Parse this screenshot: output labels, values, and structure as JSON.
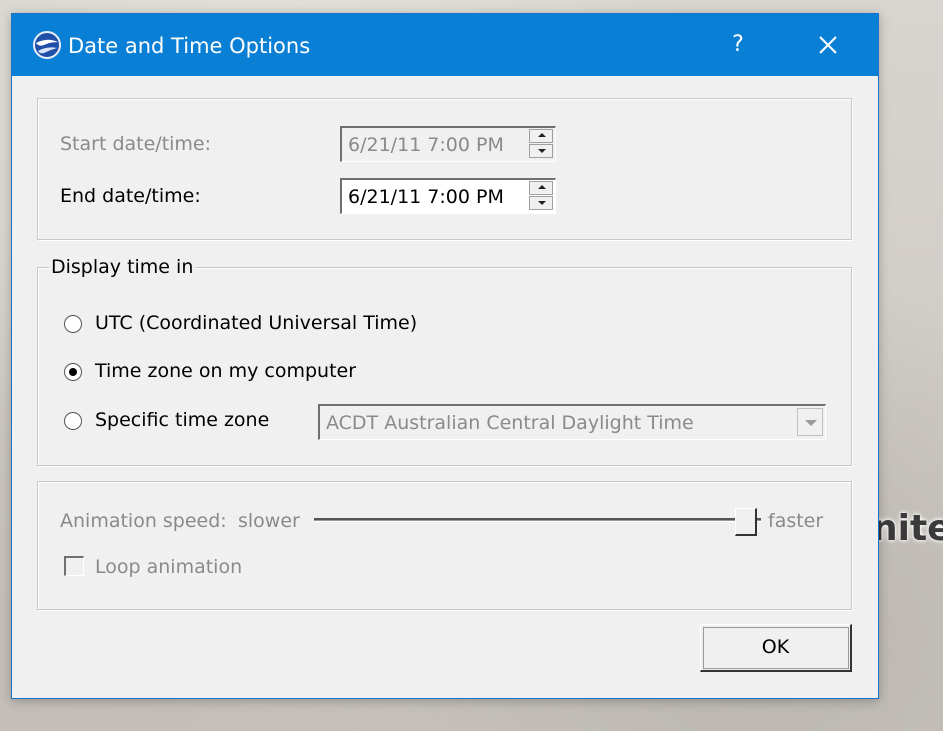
{
  "background": {
    "map_text": "nited"
  },
  "dialog": {
    "title": "Date and Time Options",
    "help_label": "?",
    "app_icon": "earth-globe-icon",
    "close_icon": "close-icon"
  },
  "time_range": {
    "start_label": "Start date/time:",
    "start_value": "6/21/11 7:00 PM",
    "start_enabled": false,
    "end_label": "End date/time:",
    "end_value": "6/21/11 7:00 PM",
    "end_enabled": true
  },
  "display_time": {
    "legend": "Display time in",
    "options": [
      {
        "label": "UTC (Coordinated Universal Time)",
        "checked": false
      },
      {
        "label": "Time zone on my computer",
        "checked": true
      },
      {
        "label": "Specific time zone",
        "checked": false
      }
    ],
    "timezone_value": "ACDT Australian Central Daylight Time",
    "timezone_enabled": false
  },
  "animation": {
    "speed_label": "Animation speed:",
    "slower_label": "slower",
    "faster_label": "faster",
    "speed_fraction": 0.97,
    "loop_label": "Loop animation",
    "loop_checked": false
  },
  "buttons": {
    "ok_label": "OK"
  },
  "colors": {
    "titlebar": "#0a7fd6",
    "dialog_bg": "#f0f0f0",
    "disabled_text": "#8a8a8a"
  }
}
